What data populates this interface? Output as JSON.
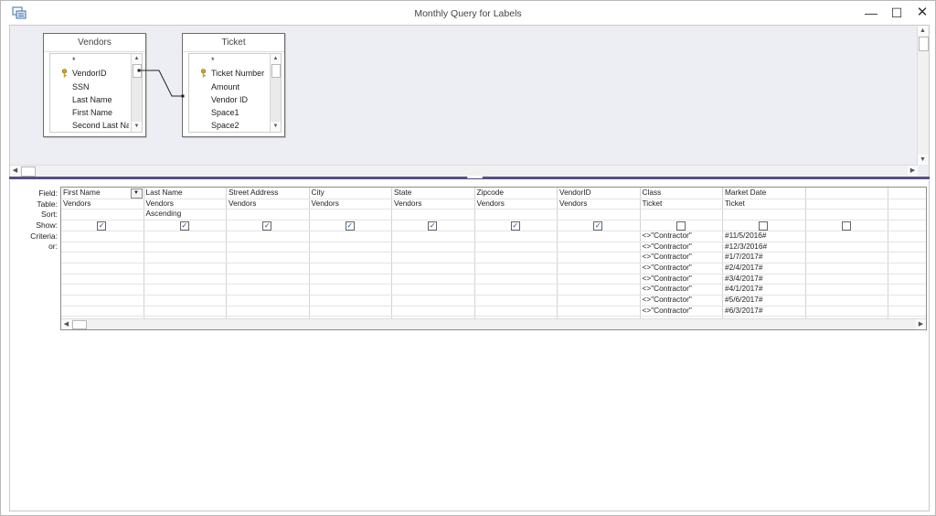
{
  "window": {
    "title": "Monthly Query for Labels"
  },
  "icons": {
    "app": "query-icon",
    "minimize": "minimize-icon",
    "maximize": "maximize-icon",
    "close": "close-icon",
    "primary_key": "key-icon"
  },
  "colors": {
    "designer_bg": "#edeef3",
    "splitter": "#5b4f83",
    "key": "#c9a227",
    "check": "#254a86"
  },
  "tables": [
    {
      "name": "Vendors",
      "fields": [
        "*",
        "VendorID",
        "SSN",
        "Last Name",
        "First Name",
        "Second Last Na"
      ],
      "key_index": 1
    },
    {
      "name": "Ticket",
      "fields": [
        "*",
        "Ticket Number",
        "Amount",
        "Vendor ID",
        "Space1",
        "Space2"
      ],
      "key_index": 1
    }
  ],
  "grid": {
    "row_labels": [
      "Field:",
      "Table:",
      "Sort:",
      "Show:",
      "Criteria:",
      "or:"
    ],
    "columns": [
      {
        "field": "First Name",
        "table": "Vendors",
        "sort": "",
        "show": true,
        "criteria": [],
        "active": true
      },
      {
        "field": "Last Name",
        "table": "Vendors",
        "sort": "Ascending",
        "show": true,
        "criteria": []
      },
      {
        "field": "Street Address",
        "table": "Vendors",
        "sort": "",
        "show": true,
        "criteria": []
      },
      {
        "field": "City",
        "table": "Vendors",
        "sort": "",
        "show": true,
        "criteria": []
      },
      {
        "field": "State",
        "table": "Vendors",
        "sort": "",
        "show": true,
        "criteria": []
      },
      {
        "field": "Zipcode",
        "table": "Vendors",
        "sort": "",
        "show": true,
        "criteria": []
      },
      {
        "field": "VendorID",
        "table": "Vendors",
        "sort": "",
        "show": true,
        "criteria": []
      },
      {
        "field": "Class",
        "table": "Ticket",
        "sort": "",
        "show": false,
        "criteria": [
          "<>\"Contractor\"",
          "<>\"Contractor\"",
          "<>\"Contractor\"",
          "<>\"Contractor\"",
          "<>\"Contractor\"",
          "<>\"Contractor\"",
          "<>\"Contractor\"",
          "<>\"Contractor\""
        ]
      },
      {
        "field": "Market Date",
        "table": "Ticket",
        "sort": "",
        "show": false,
        "criteria": [
          "#11/5/2016#",
          "#12/3/2016#",
          "#1/7/2017#",
          "#2/4/2017#",
          "#3/4/2017#",
          "#4/1/2017#",
          "#5/6/2017#",
          "#6/3/2017#"
        ]
      },
      {
        "field": "",
        "table": "",
        "sort": "",
        "show": false,
        "criteria": []
      },
      {
        "field": "",
        "table": "",
        "sort": "",
        "show": null,
        "criteria": []
      }
    ]
  }
}
